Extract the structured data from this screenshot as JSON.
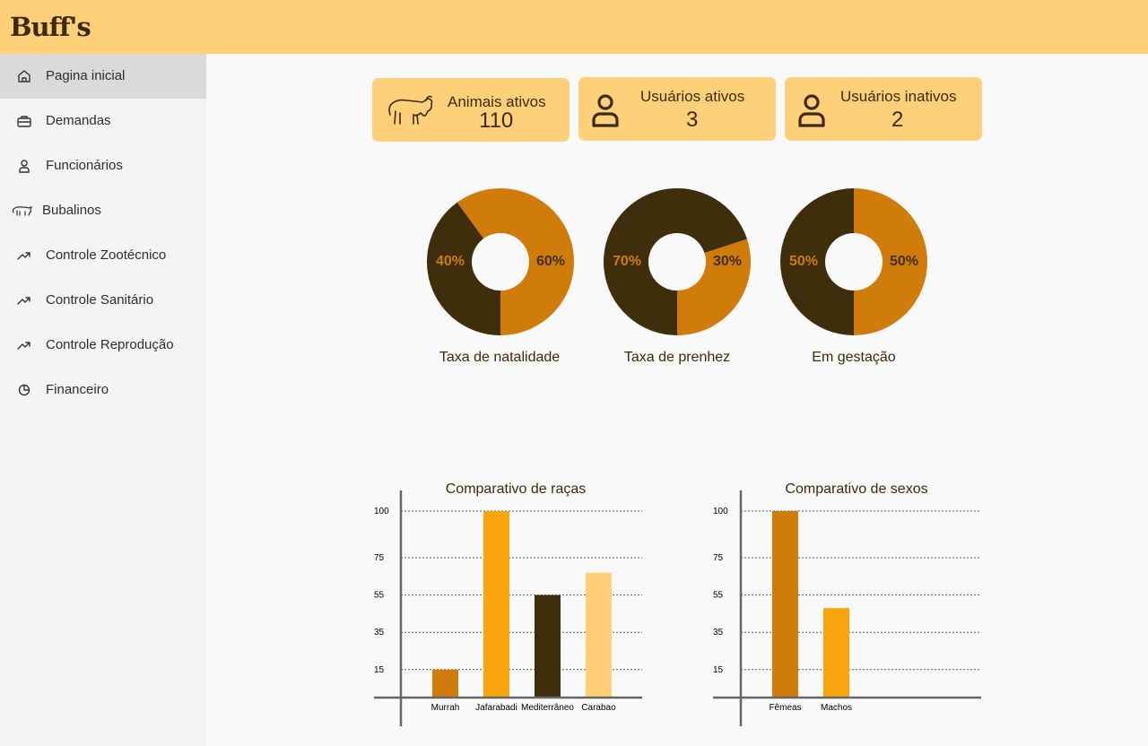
{
  "app": {
    "logo_text": "Buff's"
  },
  "sidebar": {
    "items": [
      {
        "label": "Pagina inicial",
        "icon": "home-icon",
        "active": true
      },
      {
        "label": "Demandas",
        "icon": "briefcase-icon"
      },
      {
        "label": "Funcionários",
        "icon": "user-icon"
      },
      {
        "label": "Bubalinos",
        "icon": "buffalo-icon"
      },
      {
        "label": "Controle Zootécnico",
        "icon": "trending-up-icon"
      },
      {
        "label": "Controle Sanitário",
        "icon": "trending-up-icon"
      },
      {
        "label": "Controle Reprodução",
        "icon": "trending-up-icon"
      },
      {
        "label": "Financeiro",
        "icon": "pie-chart-icon"
      }
    ]
  },
  "cards": [
    {
      "title": "Animais ativos",
      "value": "110",
      "icon": "buffalo-icon"
    },
    {
      "title": "Usuários ativos",
      "value": "3",
      "icon": "user-icon"
    },
    {
      "title": "Usuários inativos",
      "value": "2",
      "icon": "user-icon"
    }
  ],
  "colors": {
    "orange": "#d07c0a",
    "dark_brown": "#3f2e0c",
    "amber": "#faa50f",
    "light_orange": "#ffcf7a",
    "header": "#ffd07a"
  },
  "donuts": [
    {
      "label": "Taxa de natalidade",
      "left_pct": "40%",
      "right_pct": "60%",
      "dark_share": 0.4,
      "orange_share": 0.6
    },
    {
      "label": "Taxa de prenhez",
      "left_pct": "70%",
      "right_pct": "30%",
      "dark_share": 0.7,
      "orange_share": 0.3
    },
    {
      "label": "Em gestação",
      "left_pct": "50%",
      "right_pct": "50%",
      "dark_share": 0.5,
      "orange_share": 0.5
    }
  ],
  "chart_data": [
    {
      "type": "bar",
      "title": "Comparativo de raças",
      "categories": [
        "Murrah",
        "Jafarabadi",
        "Mediterrâneo",
        "Carabao"
      ],
      "values": [
        15,
        100,
        55,
        67
      ],
      "bar_colors": [
        "#d07c0a",
        "#faa50f",
        "#3f2e0c",
        "#ffcf7a"
      ],
      "y_ticks": [
        "15",
        "35",
        "55",
        "75",
        "100"
      ],
      "ylim": [
        0,
        100
      ],
      "grid": true
    },
    {
      "type": "bar",
      "title": "Comparativo de sexos",
      "categories": [
        "Fêmeas",
        "Machos"
      ],
      "values": [
        100,
        48
      ],
      "bar_colors": [
        "#d07c0a",
        "#faa50f"
      ],
      "y_ticks": [
        "15",
        "35",
        "55",
        "75",
        "100"
      ],
      "ylim": [
        0,
        100
      ],
      "grid": true
    }
  ]
}
